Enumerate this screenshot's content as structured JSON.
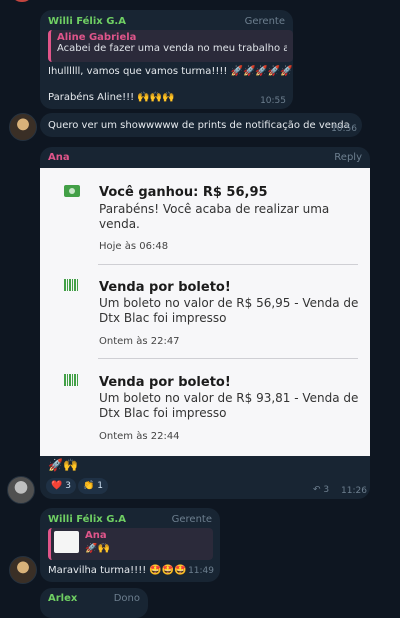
{
  "msg1": {
    "sender": "Willi Félix G.A",
    "role": "Gerente",
    "reply_name": "Aline Gabriela",
    "reply_text": "Acabei de fazer uma venda no meu trabalho aq...",
    "line1": "Ihullllll, vamos que vamos turma!!!! 🚀🚀🚀🚀🚀",
    "line2": "Parabéns Aline!!! 🙌🙌🙌",
    "time": "10:55"
  },
  "msg2": {
    "text": "Quero ver um showwwww de prints de notificação de venda",
    "time": "10:56"
  },
  "msg3": {
    "sender": "Ana",
    "reply_label": "Reply",
    "notifications": [
      {
        "title": "Você ganhou: R$ 56,95",
        "body": "Parabéns! Você acaba de realizar uma venda.",
        "time": "Hoje às 06:48"
      },
      {
        "title": "Venda por boleto!",
        "body": "Um boleto no valor de R$ 56,95 - Venda de Dtx Blac foi impresso",
        "time": "Ontem às 22:47"
      },
      {
        "title": "Venda por boleto!",
        "body": "Um boleto no valor de R$ 93,81 - Venda de Dtx Blac foi impresso",
        "time": "Ontem às 22:44"
      }
    ],
    "caption": "🚀🙌",
    "reactions": [
      {
        "emoji": "❤️",
        "count": "3"
      },
      {
        "emoji": "👏",
        "count": "1"
      }
    ],
    "forward_count": "3",
    "time": "11:26"
  },
  "msg4": {
    "sender": "Willi Félix G.A",
    "role": "Gerente",
    "reply_name": "Ana",
    "reply_text": "🚀🙌",
    "text": "Maravilha turma!!!! 🤩🤩🤩",
    "time": "11:49"
  },
  "msg5": {
    "sender": "Arlex",
    "role": "Dono"
  },
  "colors": {
    "background": "#0e1621",
    "bubble": "#182533",
    "accent_pink": "#e0558a",
    "sender_green": "#6fcf63",
    "notification_card": "#f7f7f9"
  }
}
